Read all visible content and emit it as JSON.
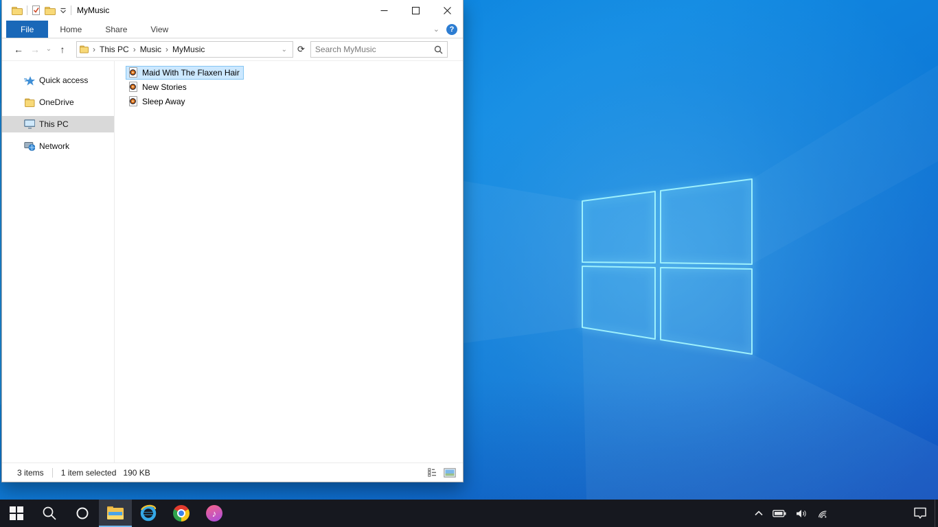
{
  "window": {
    "title": "MyMusic"
  },
  "ribbon": {
    "tabs": [
      {
        "label": "File",
        "active": true
      },
      {
        "label": "Home",
        "active": false
      },
      {
        "label": "Share",
        "active": false
      },
      {
        "label": "View",
        "active": false
      }
    ],
    "help_glyph": "?"
  },
  "navigation": {
    "breadcrumb": [
      "This PC",
      "Music",
      "MyMusic"
    ],
    "search_placeholder": "Search MyMusic"
  },
  "sidebar": {
    "items": [
      {
        "label": "Quick access",
        "icon": "quick-access-star",
        "selected": false
      },
      {
        "label": "OneDrive",
        "icon": "onedrive-folder",
        "selected": false
      },
      {
        "label": "This PC",
        "icon": "this-pc-monitor",
        "selected": true
      },
      {
        "label": "Network",
        "icon": "network-computer",
        "selected": false
      }
    ]
  },
  "files": {
    "items": [
      {
        "name": "Maid With The Flaxen Hair",
        "icon": "music-file",
        "selected": true
      },
      {
        "name": "New Stories",
        "icon": "music-file",
        "selected": false
      },
      {
        "name": "Sleep Away",
        "icon": "music-file",
        "selected": false
      }
    ]
  },
  "status_bar": {
    "items_count": "3 items",
    "selection": "1 item selected",
    "size": "190 KB"
  },
  "icons": {
    "back": "←",
    "forward": "→",
    "up": "↑",
    "refresh": "⟳",
    "chevron_down": "⌄",
    "breadcrumb_chevron": "›",
    "music_note": "♪"
  },
  "taskbar": {
    "buttons": [
      "start",
      "search",
      "cortana",
      "file-explorer",
      "internet-explorer",
      "chrome",
      "itunes"
    ],
    "active_button": "file-explorer",
    "tray": [
      "hidden-icons-chevron",
      "battery",
      "volume",
      "wifi"
    ],
    "action_center": "action-center"
  },
  "colors": {
    "file_tab_blue": "#1a68b8",
    "selection_fill": "#cce8ff",
    "selection_border": "#84c5f2",
    "sidebar_highlight": "#d9d9d9",
    "taskbar_bg": "#16181f",
    "taskbar_underline": "#76b9ed",
    "wallpaper_blue": "#0e7ad6",
    "logo_glow": "#9ef0fc"
  }
}
